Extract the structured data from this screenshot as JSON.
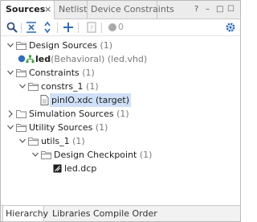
{
  "tabs": {
    "sources": "Sources",
    "close": "×",
    "netlist": "Netlist",
    "constraints": "Device Constraints"
  },
  "window_controls": {
    "help": "?",
    "minimize": "–",
    "restore": "□",
    "maximize": "☐"
  },
  "toolbar": {
    "count": "0",
    "icons": [
      "search-icon",
      "collapse-all-icon",
      "expand-all-icon",
      "add-icon",
      "properties-icon",
      "status-dot-icon",
      "settings-icon"
    ]
  },
  "tree": {
    "design_sources": {
      "label": "Design Sources",
      "count": "(1)"
    },
    "led": {
      "name": "led",
      "kind": "(Behavioral)",
      "file": "(led.vhd)"
    },
    "constraints": {
      "label": "Constraints",
      "count": "(1)"
    },
    "constrs_1": {
      "label": "constrs_1",
      "count": "(1)"
    },
    "pinio": {
      "label": "pinIO.xdc (target)"
    },
    "simulation_sources": {
      "label": "Simulation Sources",
      "count": "(1)"
    },
    "utility_sources": {
      "label": "Utility Sources",
      "count": "(1)"
    },
    "utils_1": {
      "label": "utils_1",
      "count": "(1)"
    },
    "design_checkpoint": {
      "label": "Design Checkpoint",
      "count": "(1)"
    },
    "led_dcp": {
      "label": "led.dcp"
    }
  },
  "bottom_tabs": {
    "hierarchy": "Hierarchy",
    "libraries": "Libraries",
    "compile_order": "Compile Order"
  },
  "colors": {
    "accent_blue": "#2f6db5",
    "folder_gray": "#8a8a8a",
    "selection": "#cfe0f7",
    "count_gray": "#7a7a7a"
  }
}
